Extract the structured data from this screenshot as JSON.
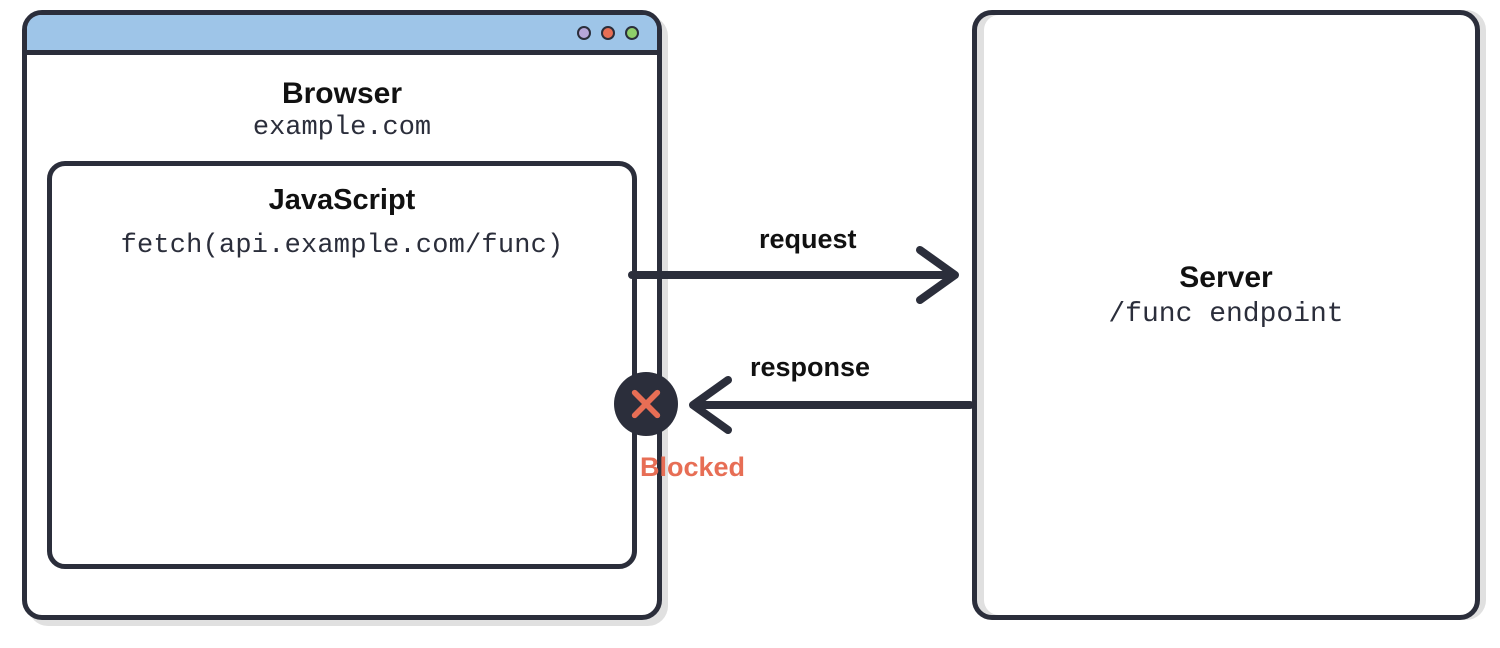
{
  "browser": {
    "title": "Browser",
    "domain": "example.com",
    "js_panel": {
      "title": "JavaScript",
      "code": "fetch(api.example.com/func)"
    },
    "traffic_lights": [
      "purple",
      "red",
      "green"
    ]
  },
  "server": {
    "title": "Server",
    "endpoint": "/func endpoint"
  },
  "arrows": {
    "request_label": "request",
    "response_label": "response"
  },
  "blocked": {
    "label": "Blocked",
    "icon": "x-icon"
  },
  "colors": {
    "stroke": "#2b2e3b",
    "titlebar": "#9ec5e8",
    "blocked": "#e76e55",
    "shadow": "#e0e0e0"
  }
}
